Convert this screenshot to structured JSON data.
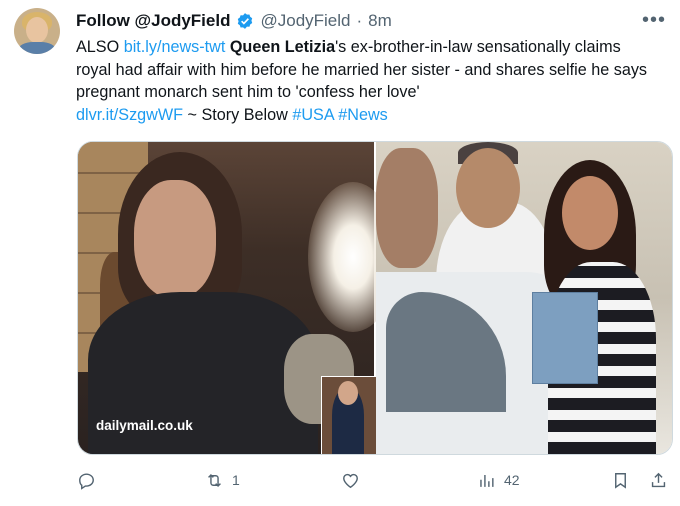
{
  "tweet": {
    "author_name": "Follow @JodyField",
    "handle": "@JodyField",
    "separator": "·",
    "time": "8m",
    "more_label": "•••",
    "text": {
      "prefix": "ALSO ",
      "link1": "bit.ly/news-twt",
      "space": " ",
      "bold": "Queen Letizia",
      "body": "'s ex-brother-in-law sensationally claims royal had affair with him before he married her sister - and shares selfie he says pregnant monarch sent him to 'confess her love'",
      "link2": "dlvr.it/SzgwWF",
      "story": " ~ Story Below ",
      "hashtag1": "#USA",
      "hashtag2": "#News"
    },
    "media": {
      "watermark": "dailymail.co.uk"
    },
    "actions": {
      "reply_count": "",
      "retweet_count": "1",
      "like_count": "",
      "views_count": "42"
    }
  },
  "colors": {
    "accent": "#1d9bf0",
    "muted": "#536471",
    "text": "#0f1419"
  },
  "icons": [
    "verified-badge-icon",
    "more-icon",
    "reply-icon",
    "retweet-icon",
    "like-icon",
    "views-icon",
    "bookmark-icon",
    "share-icon"
  ]
}
